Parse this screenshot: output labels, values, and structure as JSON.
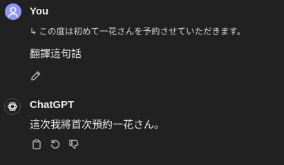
{
  "user_message": {
    "author": "You",
    "quoted_text": "この度は初めて一花さんを予約させていただきます。",
    "quote_arrow": "↳",
    "text": "翻譯這句話",
    "actions": [
      {
        "icon": "pencil-icon",
        "label": "edit"
      }
    ]
  },
  "assistant_message": {
    "author": "ChatGPT",
    "text": "這次我將首次預約一花さん。",
    "actions": [
      {
        "icon": "clipboard-icon"
      },
      {
        "icon": "regenerate-icon"
      },
      {
        "icon": "thumbs-down-icon"
      }
    ]
  },
  "colors": {
    "background": "#212121",
    "text": "#ececec",
    "user_avatar": "#8e97f3",
    "icon": "#b4b4b4"
  }
}
